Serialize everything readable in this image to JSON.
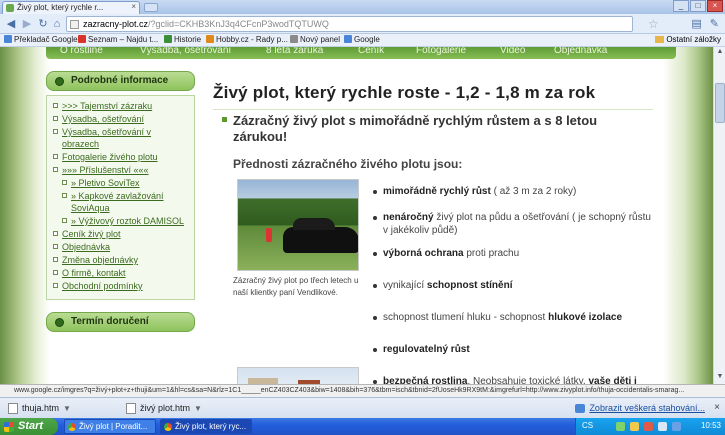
{
  "browser": {
    "tab_title": "Živý plot, který rychle r...",
    "url_host": "zazracny-plot.cz",
    "url_path": "/?gclid=CKHB3KnJ3q4CFcnP3wodTQTUWQ",
    "bookmarks": [
      {
        "label": "Překladač Google",
        "color": "#4a86d8"
      },
      {
        "label": "Seznam – Najdu t...",
        "color": "#d9342b"
      },
      {
        "label": "Historie",
        "color": "#3b8f3b"
      },
      {
        "label": "Hobby.cz - Rady p...",
        "color": "#e08a1e"
      },
      {
        "label": "Nový panel",
        "color": "#8a8a8a"
      },
      {
        "label": "Google",
        "color": "#4a86d8"
      }
    ],
    "other_bookmarks": "Ostatní záložky"
  },
  "nav": {
    "items": [
      "O rostlině",
      "Výsadba, ošetřování",
      "8 letá záruka",
      "Ceník",
      "Fotogalerie",
      "Video",
      "Objednávka"
    ]
  },
  "sidebar": {
    "heading": "Podrobné informace",
    "items": [
      {
        "label": ">>> Tajemství zázraku"
      },
      {
        "label": "Výsadba, ošetřování"
      },
      {
        "label": "Výsadba, ošetřování v obrazech"
      },
      {
        "label": "Fotogalerie živého plotu"
      },
      {
        "label": "»»» Příslušenství «««"
      },
      {
        "label": "» Pletivo SoviTex"
      },
      {
        "label": "» Kapkové zavlažování SoviAqua"
      },
      {
        "label": "» Výživový roztok DAMISOL"
      },
      {
        "label": "Ceník živý plot"
      },
      {
        "label": "Objednávka"
      },
      {
        "label": "Změna objednávky"
      },
      {
        "label": "O firmě, kontakt"
      },
      {
        "label": "Obchodní podmínky"
      }
    ],
    "heading2": "Termín doručení"
  },
  "content": {
    "title": "Živý plot, který rychle roste - 1,2 - 1,8 m za rok",
    "subtitle": "Zázračný živý plot s mimořádně rychlým růstem a s 8 letou zárukou!",
    "advantages_heading": "Přednosti zázračného živého plotu jsou:",
    "caption": "Zázračný živý plot po třech letech u naší klientky paní Vendlikové.",
    "bullets": [
      {
        "bold": "mimořádně rychlý růst",
        "rest": " ( až 3 m za 2 roky)"
      },
      {
        "bold": "nenáročný",
        "rest": " živý plot na půdu a ošetřování ( je schopný růstu v jakékoliv půdě)"
      },
      {
        "bold": "výborná ochrana",
        "rest": " proti prachu"
      },
      {
        "bold": "schopnost stínění",
        "pre": "vynikající "
      },
      {
        "bold": "hlukové izolace",
        "pre": "schopnost tlumení hluku - schopnost "
      },
      {
        "bold": "regulovatelný růst",
        "rest": ""
      },
      {
        "bold": "bezpečná rostlina",
        "rest": ". Neobsahuje toxické látky, ",
        "bold2": "vaše děti i domácí zvířata jsou v bezpečí"
      }
    ]
  },
  "status_url": "www.google.cz/imgres?q=živý+plot+z+thuji&um=1&hl=cs&sa=N&rlz=1C1_____enCZ403CZ403&biw=1408&bih=376&tbm=isch&tbnid=2fUoseHk9RX9tM:&imgrefurl=http://www.zivyplot.info/thuja-occidentalis-smarag...",
  "downloads": [
    {
      "file": "thuja.htm"
    },
    {
      "file": "živý plot.htm"
    }
  ],
  "show_all_downloads": "Zobrazit veškerá stahování...",
  "taskbar": {
    "start": "Start",
    "tasks": [
      "Živý plot | Poradit...",
      "Živý plot, který ryc..."
    ],
    "lang": "CS",
    "time": "10:53"
  }
}
